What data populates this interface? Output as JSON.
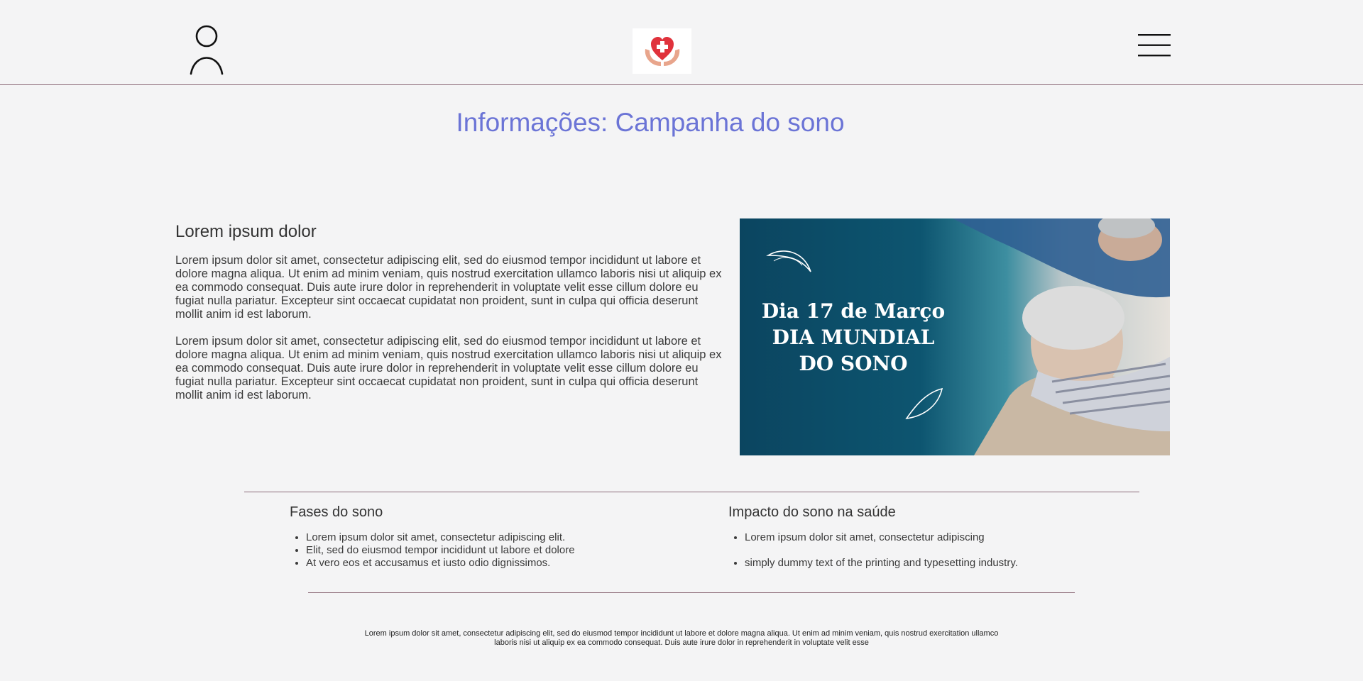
{
  "header": {
    "user_icon": "user-icon",
    "logo_icon": "heart-cross-hands-logo",
    "menu_icon": "hamburger-menu-icon"
  },
  "page": {
    "title": "Informações: Campanha do sono"
  },
  "intro": {
    "heading": "Lorem ipsum dolor",
    "paragraphs": [
      "Lorem ipsum dolor sit amet, consectetur adipiscing elit, sed do eiusmod tempor incididunt ut labore et dolore magna aliqua. Ut enim ad minim veniam, quis nostrud exercitation ullamco laboris nisi ut aliquip ex ea commodo consequat. Duis aute irure dolor in reprehenderit in voluptate velit esse cillum dolore eu fugiat nulla pariatur. Excepteur sint occaecat cupidatat non proident, sunt in culpa qui officia deserunt mollit anim id est laborum.",
      "Lorem ipsum dolor sit amet, consectetur adipiscing elit, sed do eiusmod tempor incididunt ut labore et dolore magna aliqua. Ut enim ad minim veniam, quis nostrud exercitation ullamco laboris nisi ut aliquip ex ea commodo consequat. Duis aute irure dolor in reprehenderit in voluptate velit esse cillum dolore eu fugiat nulla pariatur. Excepteur sint occaecat cupidatat non proident, sunt in culpa qui officia deserunt mollit anim id est laborum."
    ]
  },
  "banner": {
    "line1": "Dia 17 de Março",
    "line2": "DIA MUNDIAL",
    "line3": "DO SONO",
    "colors": {
      "dark": "#0b4560",
      "teal": "#1a6f86"
    }
  },
  "sections": {
    "left": {
      "heading": "Fases do sono",
      "items": [
        "Lorem ipsum dolor sit amet, consectetur adipiscing elit.",
        "Elit, sed do eiusmod tempor incididunt ut labore et dolore",
        "At vero eos et accusamus et iusto odio dignissimos."
      ]
    },
    "right": {
      "heading": "Impacto do sono na saúde",
      "items": [
        "Lorem ipsum dolor sit amet, consectetur adipiscing",
        "simply dummy text of the printing and typesetting industry."
      ]
    }
  },
  "footer": {
    "text": "Lorem ipsum dolor sit amet, consectetur adipiscing elit, sed do eiusmod tempor incididunt ut labore et dolore magna aliqua. Ut enim ad minim veniam, quis nostrud exercitation ullamco laboris nisi ut aliquip ex ea commodo consequat. Duis aute irure dolor in reprehenderit in voluptate velit esse"
  },
  "colors": {
    "title": "#6b74d6",
    "divider": "#8c6b78",
    "background": "#f4f4f5"
  }
}
